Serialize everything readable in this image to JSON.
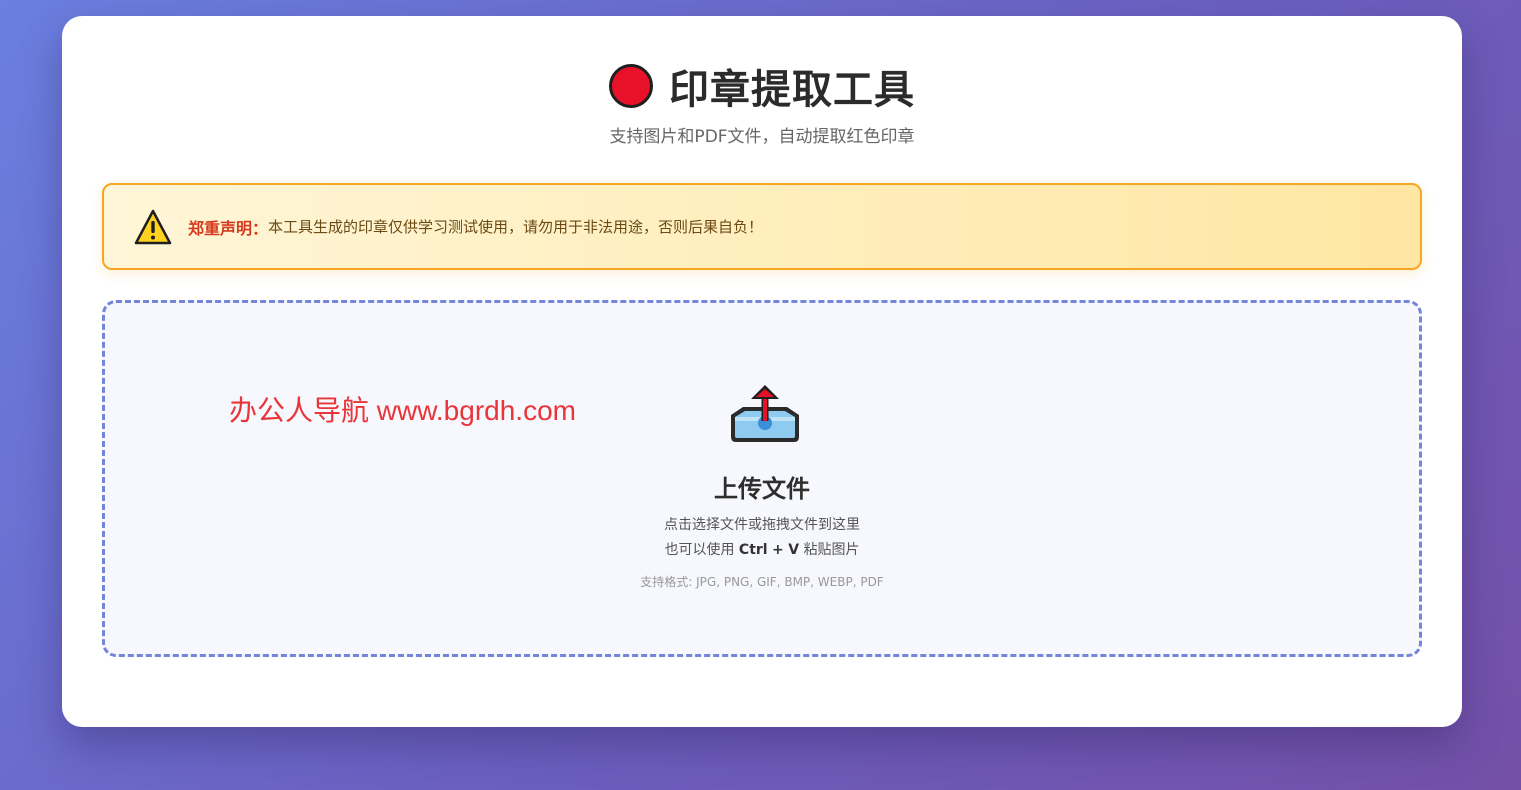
{
  "header": {
    "title": "印章提取工具",
    "subtitle": "支持图片和PDF文件，自动提取红色印章"
  },
  "warning": {
    "label": "郑重声明：",
    "text": "本工具生成的印章仅供学习测试使用，请勿用于非法用途，否则后果自负！"
  },
  "upload": {
    "watermark": "办公人导航 www.bgrdh.com",
    "title": "上传文件",
    "desc_line1": "点击选择文件或拖拽文件到这里",
    "desc_line2_prefix": "也可以使用",
    "shortcut_key1": "Ctrl",
    "shortcut_plus": "+",
    "shortcut_key2": "V",
    "desc_line2_suffix": "粘贴图片",
    "formats": "支持格式: JPG, PNG, GIF, BMP, WEBP, PDF"
  },
  "icons": {
    "title_icon": "red-circle-icon",
    "warning_icon": "warning-icon",
    "upload_icon": "upload-tray-icon"
  },
  "colors": {
    "accent": "#7585db",
    "seal_red": "#e8112a",
    "warning_border": "#f5a623",
    "watermark": "#e8353a"
  }
}
